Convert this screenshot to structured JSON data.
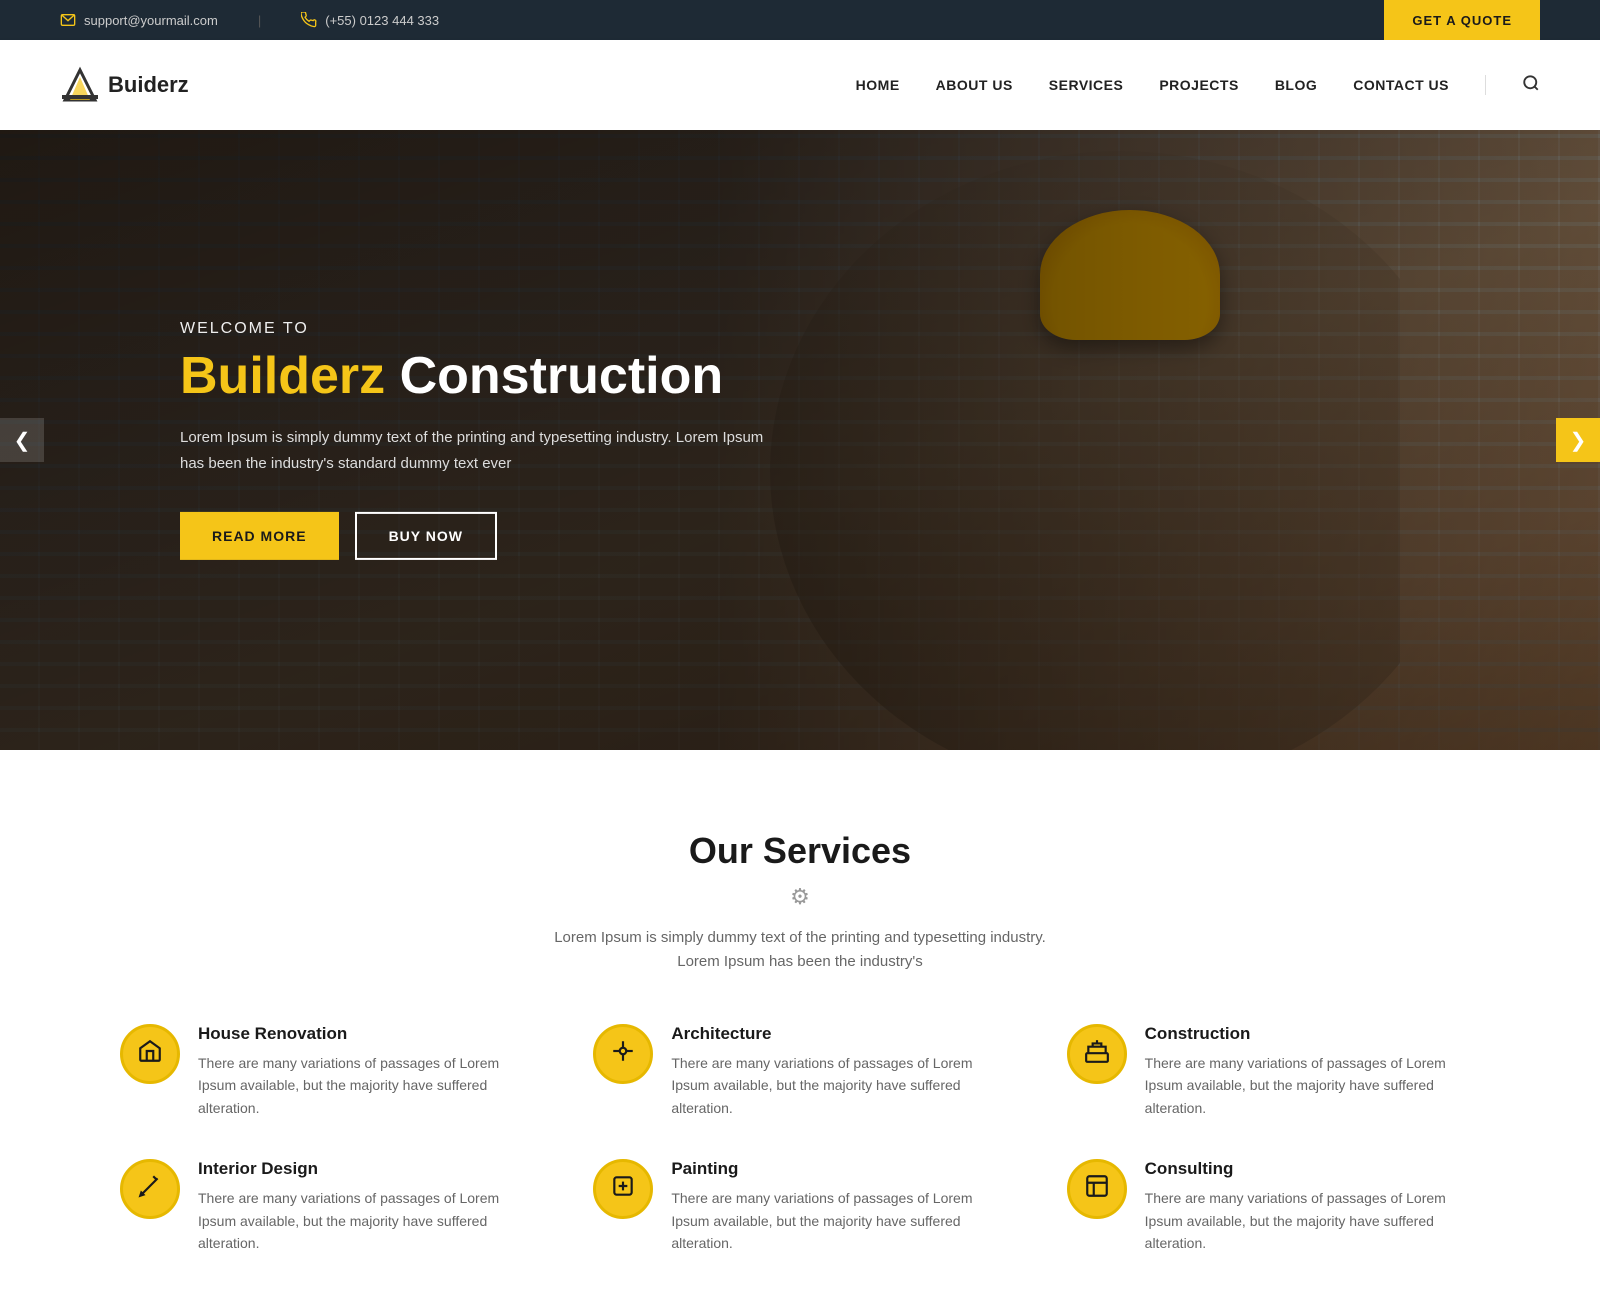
{
  "topbar": {
    "email": "support@yourmail.com",
    "phone": "(+55) 0123 444 333",
    "quote_btn": "GET A QUOTE"
  },
  "header": {
    "logo_text": "Buiderz",
    "nav": [
      {
        "label": "HOME",
        "id": "home"
      },
      {
        "label": "ABOUT US",
        "id": "about"
      },
      {
        "label": "SERVICES",
        "id": "services"
      },
      {
        "label": "PROJECTS",
        "id": "projects"
      },
      {
        "label": "BLOG",
        "id": "blog"
      },
      {
        "label": "CONTACT US",
        "id": "contact"
      }
    ]
  },
  "hero": {
    "welcome": "WELCOME TO",
    "title_highlight": "Builderz",
    "title_rest": " Construction",
    "description": "Lorem Ipsum is simply dummy text of the printing and typesetting  industry. Lorem Ipsum has been the industry's standard dummy text ever",
    "btn_read_more": "READ MORE",
    "btn_buy_now": "BUY NOW"
  },
  "services": {
    "title": "Our Services",
    "subtitle_line1": "Lorem Ipsum is simply dummy text of the printing and typesetting industry.",
    "subtitle_line2": "Lorem Ipsum has been the industry's",
    "items": [
      {
        "name": "House Renovation",
        "desc": "There are many variations of passages of Lorem Ipsum available, but the majority have suffered alteration.",
        "icon": "house"
      },
      {
        "name": "Architecture",
        "desc": "There are many variations of passages of Lorem Ipsum available, but the majority have suffered alteration.",
        "icon": "wrench"
      },
      {
        "name": "Construction",
        "desc": "There are many variations of passages of Lorem Ipsum available, but the majority have suffered alteration.",
        "icon": "construction"
      },
      {
        "name": "Interior Design",
        "desc": "There are many variations of passages of Lorem Ipsum available, but the majority have suffered alteration.",
        "icon": "design"
      },
      {
        "name": "Painting",
        "desc": "There are many variations of passages of Lorem Ipsum available, but the majority have suffered alteration.",
        "icon": "paint"
      },
      {
        "name": "Consulting",
        "desc": "There are many variations of passages of Lorem Ipsum available, but the majority have suffered alteration.",
        "icon": "consulting"
      }
    ]
  },
  "colors": {
    "accent": "#f5c518",
    "dark": "#1e2a35",
    "text": "#222222"
  }
}
